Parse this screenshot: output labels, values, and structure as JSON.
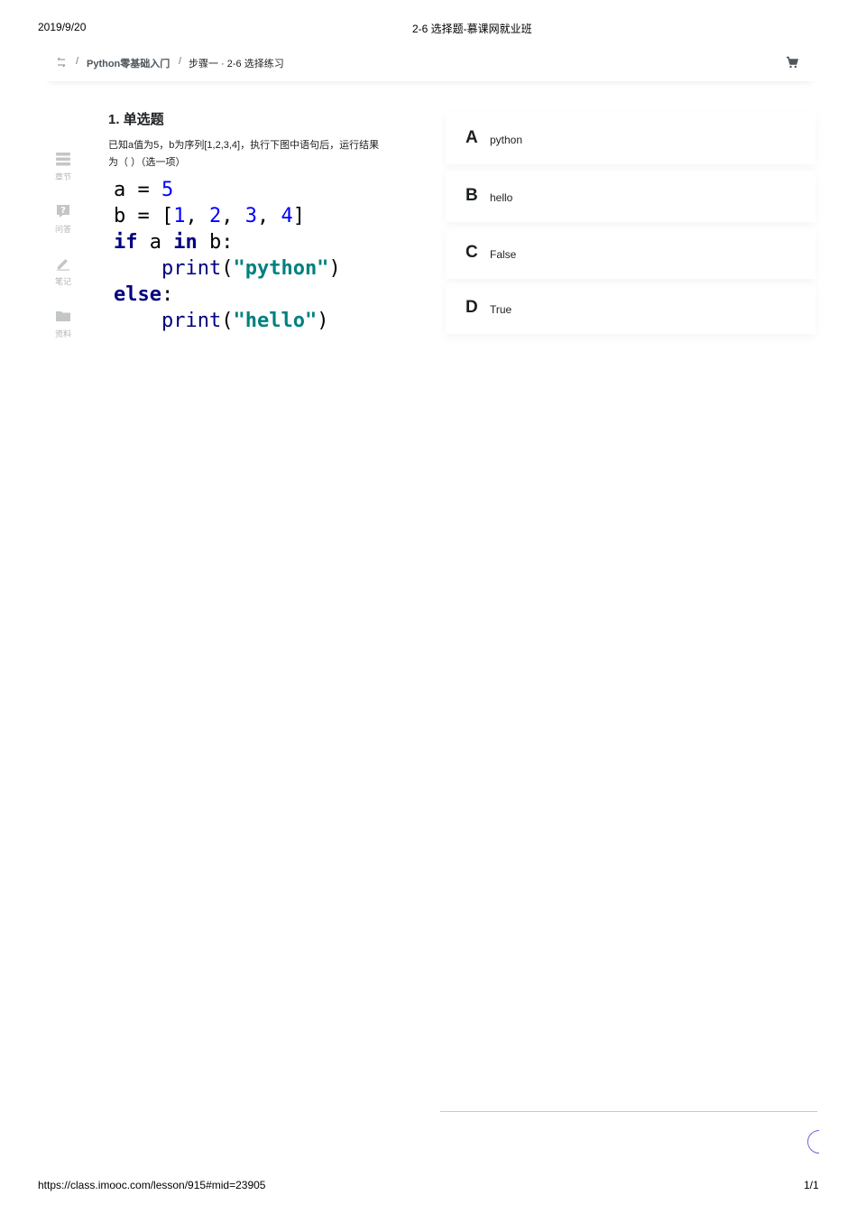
{
  "print": {
    "date": "2019/9/20",
    "title": "2-6 选择题-慕课网就业班",
    "url": "https://class.imooc.com/lesson/915#mid=23905",
    "page": "1/1"
  },
  "breadcrumb": {
    "separator": "/",
    "course": "Python零基础入门",
    "step": "步骤一 · 2-6 选择练习"
  },
  "sidebar": {
    "items": [
      {
        "label": "章节",
        "icon": "chapters-icon"
      },
      {
        "label": "问答",
        "icon": "qa-icon"
      },
      {
        "label": "笔记",
        "icon": "pencil-icon"
      },
      {
        "label": "资料",
        "icon": "folder-icon"
      }
    ]
  },
  "question": {
    "title": "1. 单选题",
    "text": "已知a值为5，b为序列[1,2,3,4]，执行下图中语句后，运行结果为（ ）（选一项）",
    "code": {
      "line1": {
        "v": "a",
        "op": " = ",
        "n": "5"
      },
      "line2": {
        "v": "b",
        "op": " = ",
        "open": "[",
        "n1": "1",
        "c1": ", ",
        "n2": "2",
        "c2": ", ",
        "n3": "3",
        "c3": ", ",
        "n4": "4",
        "close": "]"
      },
      "line3": {
        "kw_if": "if",
        "a": " a ",
        "kw_in": "in",
        "b": " b:"
      },
      "line4": {
        "indent": "    ",
        "fn": "print",
        "open": "(",
        "str": "\"python\"",
        "close": ")"
      },
      "line5": {
        "kw_else": "else",
        "colon": ":"
      },
      "line6": {
        "indent": "    ",
        "fn": "print",
        "open": "(",
        "str": "\"hello\"",
        "close": ")"
      }
    }
  },
  "options": [
    {
      "letter": "A",
      "text": "python"
    },
    {
      "letter": "B",
      "text": "hello"
    },
    {
      "letter": "C",
      "text": "False"
    },
    {
      "letter": "D",
      "text": "True"
    }
  ],
  "colors": {
    "text": "#1c1f21",
    "muted": "#b0b4b8",
    "keyword": "#000080",
    "number": "#0000ff",
    "string": "#008080",
    "accent": "#7b5ed3"
  }
}
